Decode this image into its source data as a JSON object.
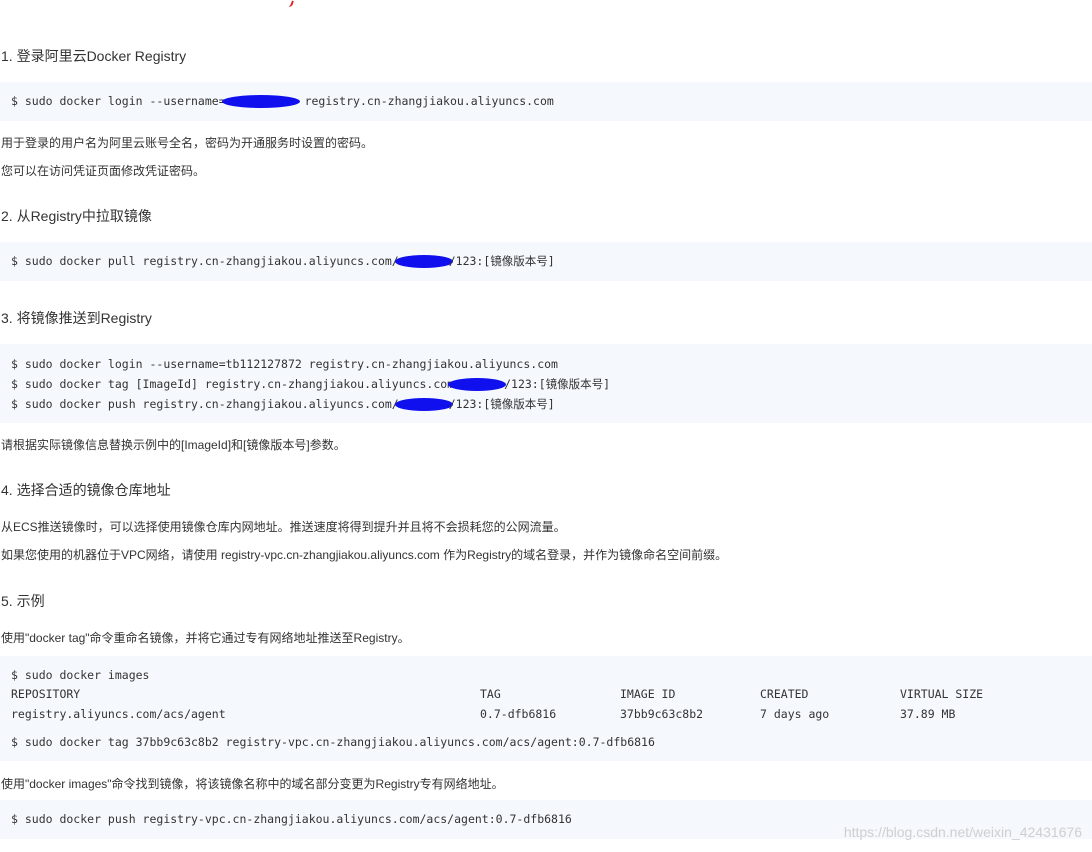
{
  "step1": {
    "heading": "1. 登录阿里云Docker Registry",
    "cmd_prefix": "$ sudo docker login --username=",
    "cmd_suffix": " registry.cn-zhangjiakou.aliyuncs.com",
    "note1": "用于登录的用户名为阿里云账号全名，密码为开通服务时设置的密码。",
    "note2": "您可以在访问凭证页面修改凭证密码。"
  },
  "step2": {
    "heading": "2. 从Registry中拉取镜像",
    "cmd_prefix": "$ sudo docker pull registry.cn-zhangjiakou.aliyuncs.com/",
    "cmd_suffix": "/123:[镜像版本号]"
  },
  "step3": {
    "heading": "3. 将镜像推送到Registry",
    "line1": "$ sudo docker login --username=tb112127872 registry.cn-zhangjiakou.aliyuncs.com",
    "line2_prefix": "$ sudo docker tag [ImageId] registry.cn-zhangjiakou.aliyuncs.com",
    "line2_suffix": "/123:[镜像版本号]",
    "line3_prefix": "$ sudo docker push registry.cn-zhangjiakou.aliyuncs.com/",
    "line3_suffix": "/123:[镜像版本号]",
    "note": "请根据实际镜像信息替换示例中的[ImageId]和[镜像版本号]参数。"
  },
  "step4": {
    "heading": "4. 选择合适的镜像仓库地址",
    "note1": "从ECS推送镜像时，可以选择使用镜像仓库内网地址。推送速度将得到提升并且将不会损耗您的公网流量。",
    "note2": "如果您使用的机器位于VPC网络，请使用 registry-vpc.cn-zhangjiakou.aliyuncs.com 作为Registry的域名登录，并作为镜像命名空间前缀。"
  },
  "step5": {
    "heading": "5. 示例",
    "intro": "使用\"docker tag\"命令重命名镜像，并将它通过专有网络地址推送至Registry。",
    "images_cmd": "$ sudo docker images",
    "table": {
      "headers": [
        "REPOSITORY",
        "TAG",
        "IMAGE ID",
        "CREATED",
        "VIRTUAL SIZE"
      ],
      "row": [
        "registry.aliyuncs.com/acs/agent",
        "0.7-dfb6816",
        "37bb9c63c8b2",
        "7 days ago",
        "37.89 MB"
      ]
    },
    "tag_cmd": "$ sudo docker tag 37bb9c63c8b2 registry-vpc.cn-zhangjiakou.aliyuncs.com/acs/agent:0.7-dfb6816",
    "note": "使用\"docker images\"命令找到镜像，将该镜像名称中的域名部分变更为Registry专有网络地址。",
    "push_cmd": "$ sudo docker push registry-vpc.cn-zhangjiakou.aliyuncs.com/acs/agent:0.7-dfb6816"
  },
  "watermark": "https://blog.csdn.net/weixin_42431676",
  "colors": {
    "code_bg": "#f5f8fc",
    "redaction": "#1010ee",
    "text": "#333333"
  }
}
